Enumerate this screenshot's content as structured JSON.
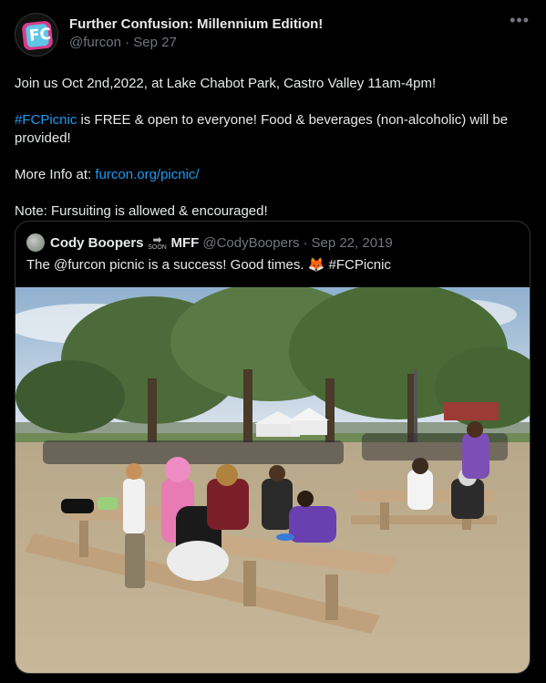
{
  "tweet": {
    "display_name": "Further Confusion: Millennium Edition!",
    "handle": "@furcon",
    "separator": "·",
    "date": "Sep 27",
    "more_icon": "ellipsis-icon",
    "line1": "Join us Oct 2nd,2022, at Lake Chabot Park, Castro Valley 11am-4pm!",
    "line2_hashtag": "#FCPicnic",
    "line2_rest": " is FREE & open to everyone! Food & beverages (non-alcoholic) will be provided!",
    "line3_label": "More Info at: ",
    "line3_link": "furcon.org/picnic/",
    "line4": "Note: Fursuiting is allowed & encouraged!"
  },
  "quote": {
    "display_name": "Cody Boopers",
    "arrow_badge": "➡",
    "arrow_text": "SOON",
    "name_suffix": "MFF",
    "handle": "@CodyBoopers",
    "separator": "·",
    "date": "Sep 22, 2019",
    "text_start": "The @furcon picnic is a success! Good times. ",
    "emoji": "🦊",
    "hashtag": "#FCPicnic"
  },
  "colors": {
    "background": "#000000",
    "text": "#e7e9ea",
    "muted": "#71767b",
    "link": "#1d9bf0",
    "border": "#2f3336"
  }
}
